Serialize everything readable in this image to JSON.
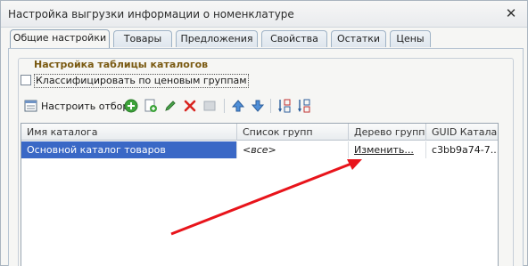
{
  "window": {
    "title": "Настройка выгрузки информации о номенклатуре",
    "close_glyph": "✕"
  },
  "tabs": [
    {
      "label": "Общие настройки",
      "active": true
    },
    {
      "label": "Товары"
    },
    {
      "label": "Предложения"
    },
    {
      "label": "Свойства"
    },
    {
      "label": "Остатки"
    },
    {
      "label": "Цены"
    }
  ],
  "catalogs_group": {
    "title": "Настройка таблицы каталогов"
  },
  "price_groups_checkbox": {
    "label": "Классифицировать по ценовым группам",
    "checked": false
  },
  "toolbar": {
    "filter_label": "Настроить отбор",
    "icons": [
      "filter-settings-icon",
      "add-icon",
      "add-copy-icon",
      "edit-icon",
      "delete-icon",
      "disabled-icon",
      "move-up-icon",
      "move-down-icon",
      "sort-asc-icon",
      "sort-desc-icon"
    ]
  },
  "grid": {
    "columns": [
      "Имя каталога",
      "Список групп",
      "Дерево групп",
      "GUID Катала..."
    ],
    "rows": [
      {
        "name": "Основной каталог товаров",
        "groups": "<все>",
        "tree": "Изменить...",
        "guid": "c3bb9a74-7..."
      }
    ]
  },
  "colors": {
    "annotation_arrow": "#e8141b",
    "selection": "#3a68c6",
    "group_title": "#7a5a12"
  }
}
